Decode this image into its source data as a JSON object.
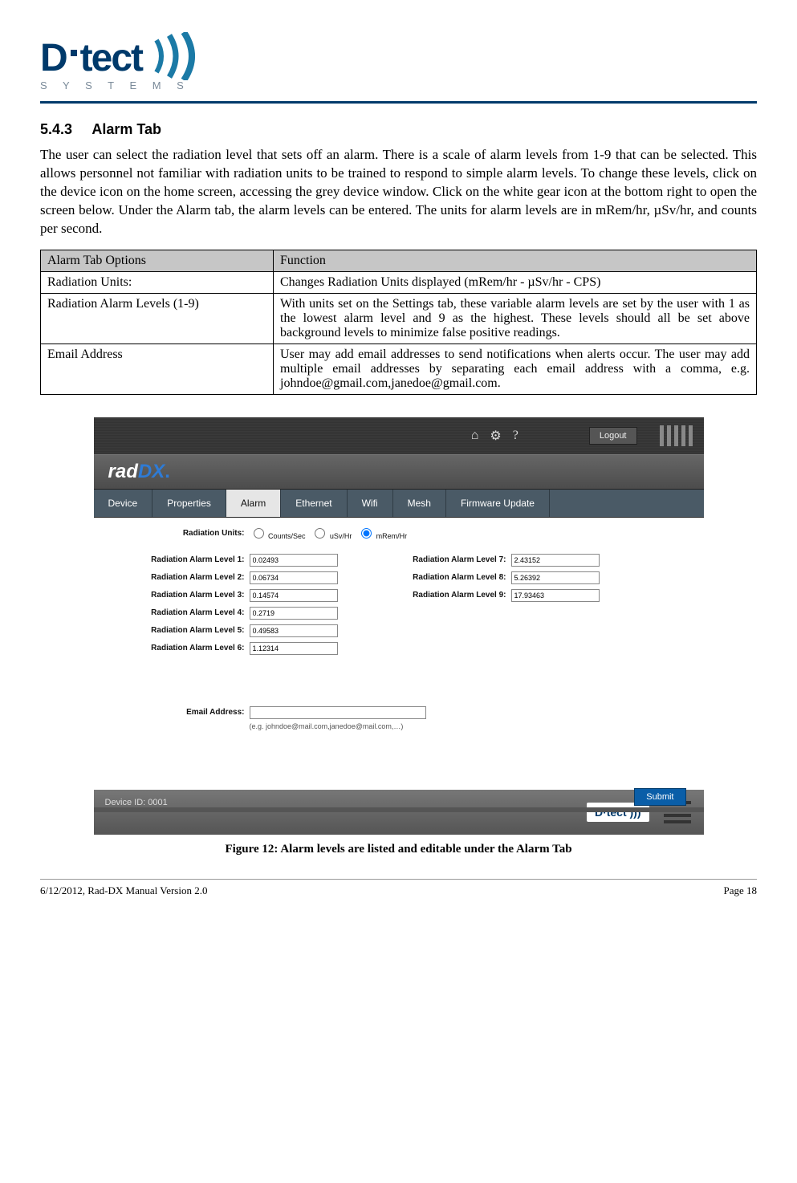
{
  "header": {
    "logo_d": "D",
    "logo_tect": "tect",
    "logo_systems": "S Y S T E M S"
  },
  "section": {
    "number": "5.4.3",
    "title": "Alarm Tab",
    "paragraph": "The user can select the radiation level that sets off an alarm. There is a scale of alarm levels from 1-9 that can be selected. This allows personnel not familiar with radiation units to be trained to respond to simple alarm levels. To change these levels, click on the device icon on the home screen, accessing the grey device window.  Click on the white gear icon at the bottom right to open the screen below. Under the Alarm tab, the alarm levels can be entered. The units for alarm levels are in mRem/hr, µSv/hr, and counts per second."
  },
  "table": {
    "head1": "Alarm Tab Options",
    "head2": "Function",
    "rows": [
      {
        "c1": "Radiation Units:",
        "c2": "Changes Radiation Units displayed (mRem/hr - µSv/hr - CPS)"
      },
      {
        "c1": "Radiation Alarm Levels (1-9)",
        "c2": "With units set on the Settings tab, these variable alarm levels are set by the user with 1 as the lowest alarm level and 9 as the highest.  These levels should all be set above background levels to minimize false positive readings."
      },
      {
        "c1": "Email Address",
        "c2": "User may add email addresses to send notifications when alerts occur.  The user may add multiple email addresses by separating each email address with a comma, e.g. johndoe@gmail.com,janedoe@gmail.com."
      }
    ]
  },
  "screenshot": {
    "logout": "Logout",
    "brand_rad": "rad",
    "brand_dx": "DX",
    "tabs": [
      "Device",
      "Properties",
      "Alarm",
      "Ethernet",
      "Wifi",
      "Mesh",
      "Firmware Update"
    ],
    "active_tab_index": 2,
    "radiation_units_label": "Radiation Units:",
    "radio_options": [
      "Counts/Sec",
      "uSv/Hr",
      "mRem/Hr"
    ],
    "radio_selected_index": 2,
    "levels_left": [
      {
        "lbl": "Radiation Alarm Level 1:",
        "val": "0.02493"
      },
      {
        "lbl": "Radiation Alarm Level 2:",
        "val": "0.06734"
      },
      {
        "lbl": "Radiation Alarm Level 3:",
        "val": "0.14574"
      },
      {
        "lbl": "Radiation Alarm Level 4:",
        "val": "0.2719"
      },
      {
        "lbl": "Radiation Alarm Level 5:",
        "val": "0.49583"
      },
      {
        "lbl": "Radiation Alarm Level 6:",
        "val": "1.12314"
      }
    ],
    "levels_right": [
      {
        "lbl": "Radiation Alarm Level 7:",
        "val": "2.43152"
      },
      {
        "lbl": "Radiation Alarm Level 8:",
        "val": "5.26392"
      },
      {
        "lbl": "Radiation Alarm Level 9:",
        "val": "17.93463"
      }
    ],
    "email_label": "Email Address:",
    "email_value": "",
    "email_hint": "(e.g. johndoe@mail.com,janedoe@mail.com,…)",
    "device_id": "Device ID: 0001",
    "submit": "Submit",
    "footer_logo": "D·tect )))"
  },
  "figure_caption": "Figure 12: Alarm levels are listed and editable under the Alarm Tab",
  "footer": {
    "left": "6/12/2012, Rad-DX Manual Version 2.0",
    "right": "Page 18"
  }
}
